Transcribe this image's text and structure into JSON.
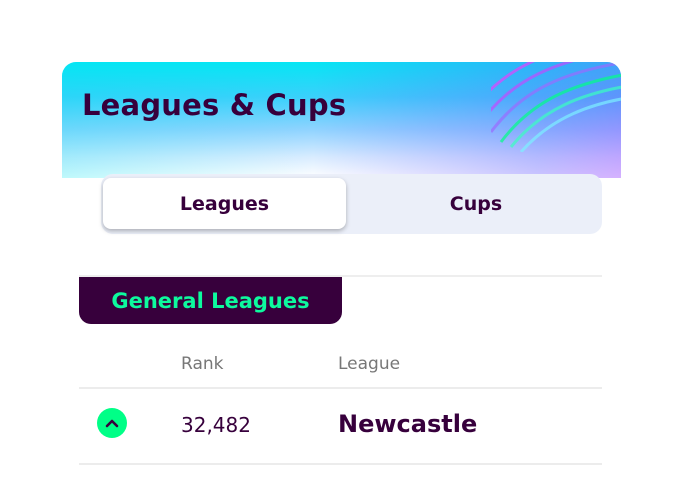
{
  "header": {
    "title": "Leagues & Cups"
  },
  "tabs": [
    {
      "label": "Leagues",
      "active": true
    },
    {
      "label": "Cups",
      "active": false
    }
  ],
  "section": {
    "label": "General Leagues"
  },
  "table": {
    "columns": [
      "Rank",
      "League"
    ],
    "rows": [
      {
        "movement": "up",
        "rank": "32,482",
        "league": "Newcastle"
      }
    ]
  },
  "icons": {
    "movement_up": "chevron-up-icon"
  },
  "colors": {
    "brand_purple": "#37003c",
    "accent_green": "#00ff87",
    "section_label_text": "#0dfa9e",
    "tab_background": "#ebeff9",
    "header_cyan": "#05e6f4"
  }
}
